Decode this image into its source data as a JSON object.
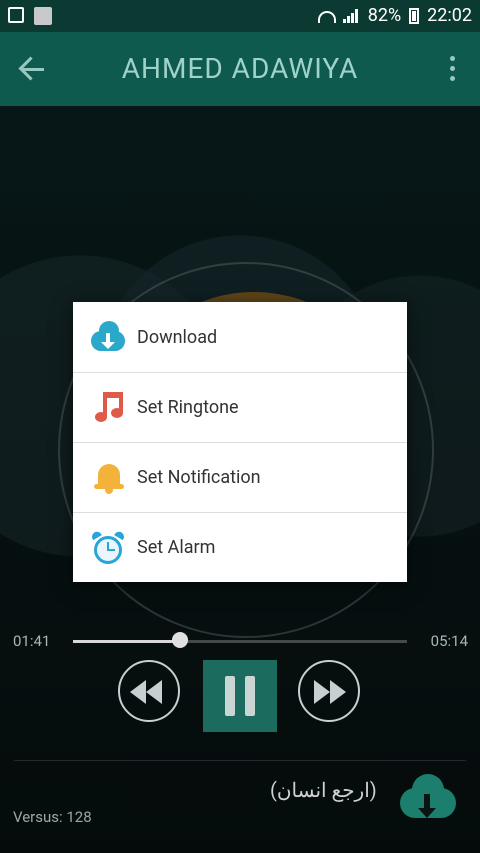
{
  "statusbar": {
    "battery": "82%",
    "time": "22:02"
  },
  "appbar": {
    "title": "AHMED ADAWIYA"
  },
  "menu": {
    "items": [
      {
        "label": "Download",
        "icon": "cloud-download-icon"
      },
      {
        "label": "Set Ringtone",
        "icon": "music-note-icon"
      },
      {
        "label": "Set Notification",
        "icon": "bell-icon"
      },
      {
        "label": "Set Alarm",
        "icon": "alarm-clock-icon"
      }
    ]
  },
  "player": {
    "elapsed": "01:41",
    "duration": "05:14",
    "progress_fraction": 0.32
  },
  "now_playing": {
    "title": "(ارجع انسان)"
  },
  "footer": {
    "version": "Versus: 128"
  },
  "colors": {
    "appbar": "#0e5a4f",
    "statusbar": "#0b3a33",
    "accent": "#1b6b5f"
  }
}
